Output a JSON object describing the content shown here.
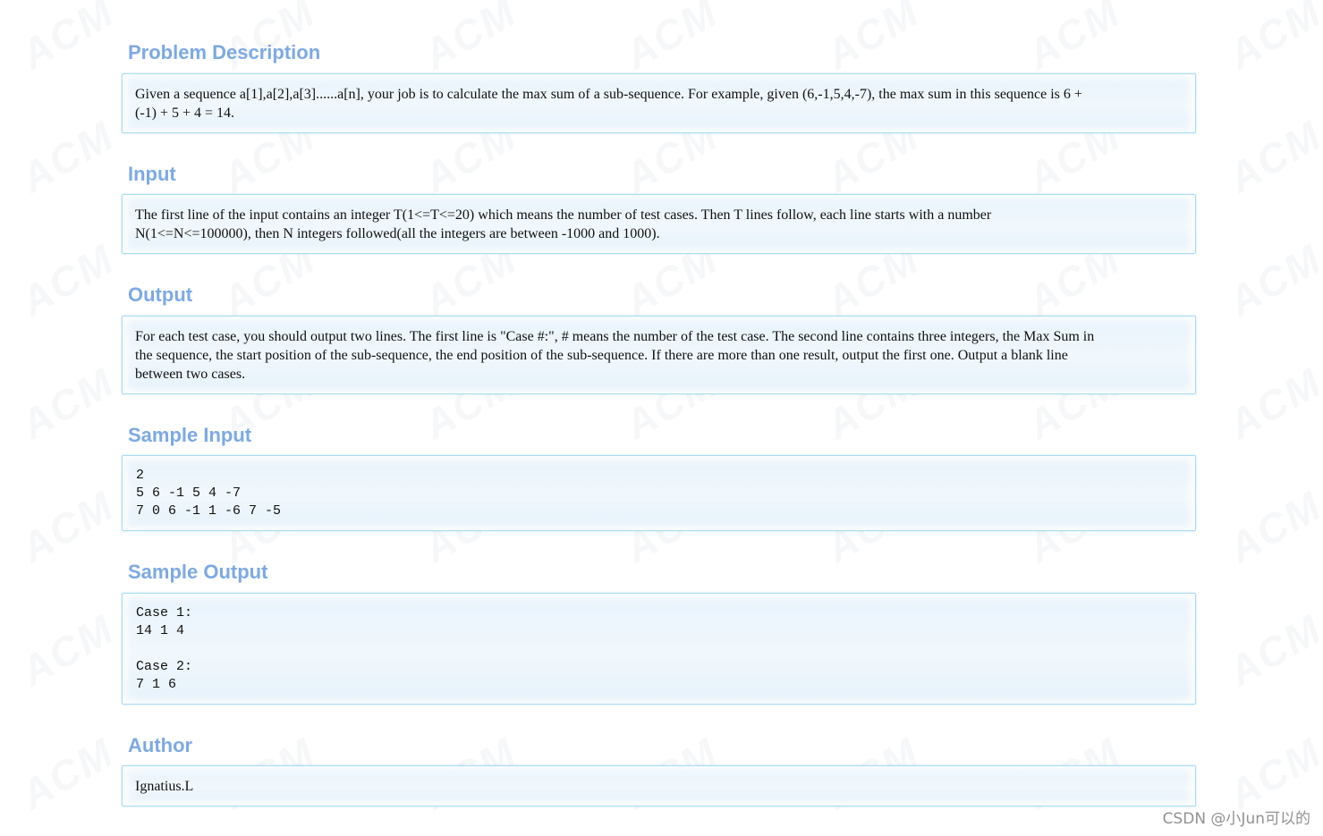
{
  "watermark": {
    "text": "ACM"
  },
  "sections": [
    {
      "title": "Problem Description",
      "kind": "text",
      "body": "Given a sequence a[1],a[2],a[3]......a[n], your job is to calculate the max sum of a sub-sequence. For example, given (6,-1,5,4,-7), the max sum in this sequence is 6 +\n(-1) + 5 + 4 = 14."
    },
    {
      "title": "Input",
      "kind": "text",
      "body": "The first line of the input contains an integer T(1<=T<=20) which means the number of test cases. Then T lines follow, each line starts with a number\nN(1<=N<=100000), then N integers followed(all the integers are between -1000 and 1000)."
    },
    {
      "title": "Output",
      "kind": "text",
      "body": "For each test case, you should output two lines. The first line is \"Case #:\", # means the number of the test case. The second line contains three integers, the Max Sum in\nthe sequence, the start position of the sub-sequence, the end position of the sub-sequence. If there are more than one result, output the first one. Output a blank line\nbetween two cases."
    },
    {
      "title": "Sample Input",
      "kind": "code",
      "body": "2\n5 6 -1 5 4 -7\n7 0 6 -1 1 -6 7 -5"
    },
    {
      "title": "Sample Output",
      "kind": "code",
      "body": "Case 1:\n14 1 4\n\nCase 2:\n7 1 6"
    },
    {
      "title": "Author",
      "kind": "text",
      "body": "Ignatius.L"
    }
  ],
  "footer": {
    "csdn_watermark": "CSDN @小Jun可以的"
  }
}
